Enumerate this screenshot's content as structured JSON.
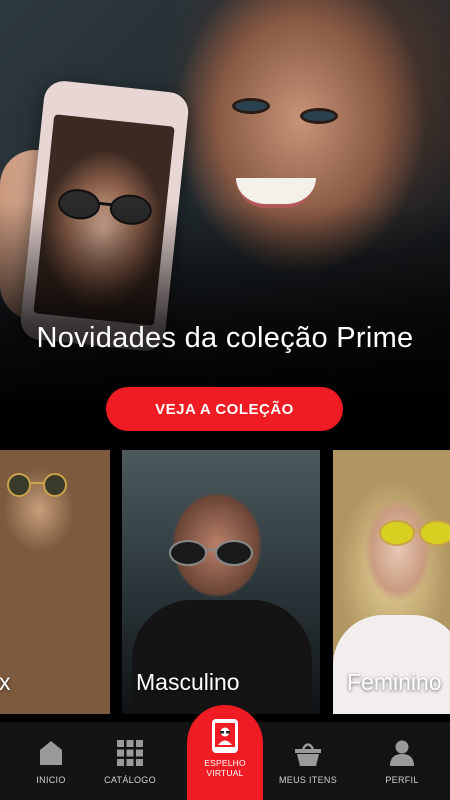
{
  "hero": {
    "title": "Novidades da coleção Prime",
    "cta_label": "VEJA A COLEÇÃO"
  },
  "categories": [
    {
      "label": "Unissex",
      "visible_label": "x"
    },
    {
      "label": "Masculino"
    },
    {
      "label": "Feminino"
    }
  ],
  "bottom_nav": {
    "items": [
      {
        "label": "INICIO",
        "icon": "home-icon"
      },
      {
        "label": "CATÁLOGO",
        "icon": "grid-icon"
      },
      {
        "label": "ESPELHO\nVIRTUAL",
        "icon": "phone-mirror-icon"
      },
      {
        "label": "MEUS ITENS",
        "icon": "basket-icon"
      },
      {
        "label": "PERFIL",
        "icon": "user-icon"
      }
    ]
  },
  "colors": {
    "accent": "#ef1c24",
    "nav_background": "#141414",
    "background": "#000000"
  }
}
